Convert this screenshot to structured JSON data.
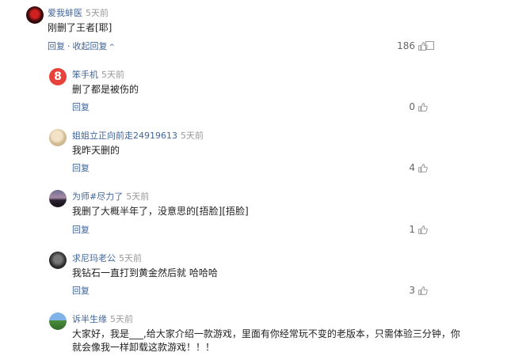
{
  "comments": [
    {
      "user": "爱我蚌医",
      "time": "5天前",
      "text": "刚删了王者[耶]",
      "reply_label": "回复",
      "collapse_label": "收起回复",
      "likes": "186"
    },
    {
      "user": "笨手机",
      "time": "5天前",
      "text": "删了都是被伤的",
      "reply_label": "回复",
      "likes": "0"
    },
    {
      "user": "姐姐立正向前走24919613",
      "time": "5天前",
      "text": "我昨天删的",
      "reply_label": "回复",
      "likes": "4"
    },
    {
      "user": "为师#尽力了",
      "time": "5天前",
      "text": "我删了大概半年了，没意思的[捂脸][捂脸]",
      "reply_label": "回复",
      "likes": "1"
    },
    {
      "user": "求尼玛老公",
      "time": "5天前",
      "text": "我钻石一直打到黄金然后就 哈哈哈",
      "reply_label": "回复",
      "likes": "3"
    },
    {
      "user": "诉半生缘",
      "time": "5天前",
      "text_line1": "大家好，我是___,给大家介绍一款游戏，里面有你经常玩不变的老版本，只需体验三分钟，你",
      "text_line2": "就会像我一样卸载这款游戏！！！"
    }
  ],
  "avatar2_glyph": "8",
  "sep": "·",
  "caret": "^",
  "colors": {
    "link": "#406599",
    "time": "#999999"
  }
}
